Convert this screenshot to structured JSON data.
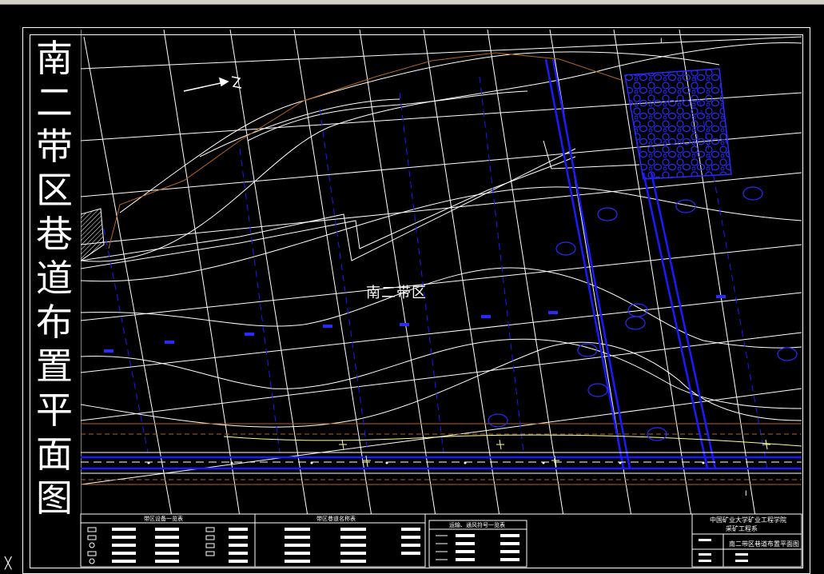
{
  "title": {
    "chars": [
      "南",
      "二",
      "带",
      "区",
      "巷",
      "道",
      "布",
      "置",
      "平",
      "面",
      "图"
    ]
  },
  "drawing": {
    "area_label": "南二带区"
  },
  "tables": {
    "equipment_title": "带区设备一览表",
    "roadway_title": "带区巷道名称表",
    "ventilation_title": "运输、通风符号一览表"
  },
  "title_block": {
    "school": "中国矿业大学矿业工程学院",
    "department": "采矿工程系",
    "drawing_name": "南二带区巷道布置平面图"
  },
  "colors": {
    "background": "#000000",
    "lines": "#ffffff",
    "roadway": "#1a1aff",
    "boundary": "#b5651d",
    "highlight": "#ffff99"
  },
  "icons": {
    "north_arrow": "north-arrow-icon",
    "ucs": "ucs-icon"
  }
}
